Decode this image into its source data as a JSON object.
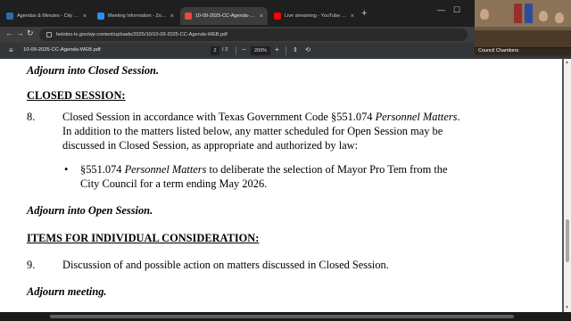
{
  "browser": {
    "tabs": [
      {
        "title": "Agendas & Minutes - City of H...",
        "favicon_color": "#2b6cb0",
        "active": false
      },
      {
        "title": "Meeting Information - Zoom",
        "favicon_color": "#2d8cff",
        "active": false
      },
      {
        "title": "10-09-2025-CC-Agenda-WEB.p...",
        "favicon_color": "#e04e39",
        "active": true
      },
      {
        "title": "Live streaming - YouTube Stud...",
        "favicon_color": "#ff0000",
        "active": false
      }
    ],
    "new_tab": "+",
    "url": "helotes-tx.gov/wp-content/uploads/2025/10/10-09-2025-CC-Agenda-WEB.pdf"
  },
  "pdf_toolbar": {
    "file_name": "10-09-2025-CC-Agenda-WEB.pdf",
    "current_page": "2",
    "total_pages": "/ 2",
    "zoom": "200%",
    "zoom_out": "−",
    "zoom_in": "+"
  },
  "video": {
    "label": "Council Chambers"
  },
  "document": {
    "adjourn_closed": "Adjourn into Closed Session.",
    "closed_heading": "CLOSED SESSION:",
    "item8_num": "8.",
    "item8_line1_a": "Closed Session in accordance with Texas Government Code §551.074 ",
    "item8_line1_b": "Personnel Matters",
    "item8_line1_c": ".",
    "item8_line2": "In addition to the matters listed below, any matter scheduled for Open Session may be",
    "item8_line3": "discussed in Closed Session, as appropriate and authorized by law:",
    "bullet": "•",
    "bullet_line1_a": "§551.074 ",
    "bullet_line1_b": "Personnel Matters",
    "bullet_line1_c": " to deliberate the selection of Mayor Pro Tem from the",
    "bullet_line2": "City Council for a term ending May 2026.",
    "adjourn_open": "Adjourn into Open Session.",
    "items_heading": "ITEMS FOR INDIVIDUAL CONSIDERATION:",
    "item9_num": "9.",
    "item9_text": "Discussion of and possible action on matters discussed in Closed Session.",
    "adjourn_meeting": "Adjourn meeting."
  }
}
